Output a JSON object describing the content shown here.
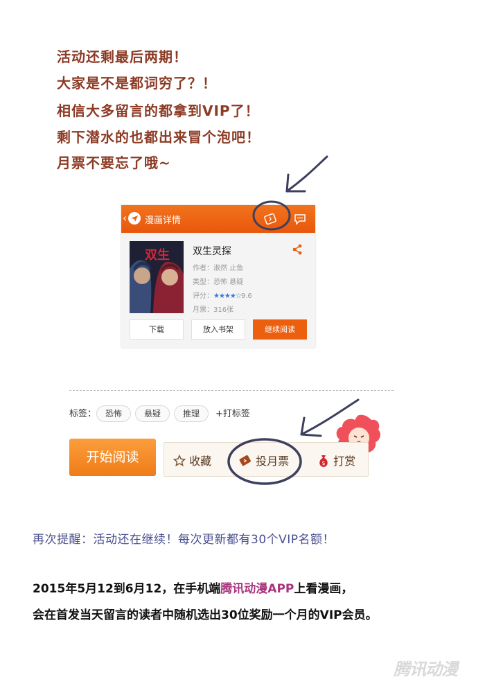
{
  "notice": {
    "lines": [
      "活动还剩最后两期！",
      "大家是不是都词穷了？！",
      "相信大多留言的都拿到VIP了！",
      "剩下潜水的也都出来冒个泡吧！",
      "月票不要忘了哦~"
    ]
  },
  "app_card": {
    "header_title": "漫画详情",
    "book_title": "双生灵探",
    "author_label": "作者：",
    "author": "淑然 止鱼",
    "type_label": "类型：",
    "type": "恐怖 悬疑",
    "rating_label": "评分：",
    "rating": "9.6",
    "rating_stars": 4.5,
    "monthly_label": "月票：",
    "monthly_votes": "316张",
    "buttons": {
      "download": "下载",
      "add_shelf": "放入书架",
      "continue": "继续阅读"
    },
    "cover_text": "双生灵探"
  },
  "tags": {
    "label": "标签：",
    "items": [
      "恐怖",
      "悬疑",
      "推理"
    ],
    "add_tag": "+打标签"
  },
  "actions": {
    "start_read": "开始阅读",
    "favorite": "收藏",
    "vote_monthly": "投月票",
    "reward": "打赏"
  },
  "reminder": "再次提醒：活动还在继续！每次更新都有30个VIP名额！",
  "info": {
    "line1_pre": "2015年5月12到6月12，在手机端",
    "line1_brand": "腾讯动漫APP",
    "line1_post": "上看漫画，",
    "line2": "会在首发当天留言的读者中随机选出30位奖励一个月的VIP会员。"
  },
  "watermark": "腾讯动漫",
  "colors": {
    "notice_text": "#8c3b25",
    "header_orange": "#ec5f0e",
    "reminder_text": "#4a4f8f",
    "brand_text": "#a8367e",
    "annotation_ink": "#3d3f5e"
  },
  "icons": {
    "header_left": "send-icon",
    "header_ticket": "ticket-icon",
    "header_comment": "comment-icon",
    "share": "share-icon",
    "favorite": "star-outline-icon",
    "vote": "ticket-icon",
    "reward": "money-bag-icon"
  }
}
